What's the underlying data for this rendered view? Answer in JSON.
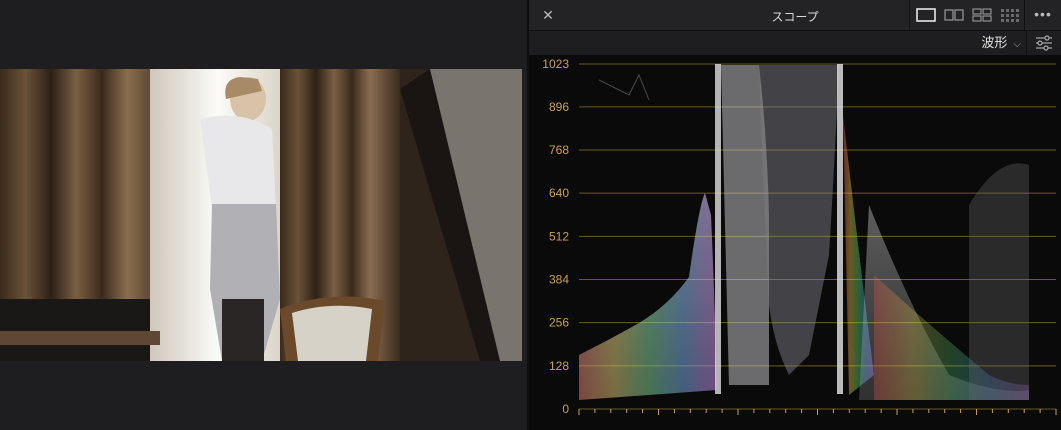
{
  "scope": {
    "title": "スコープ",
    "close_icon": "close-icon",
    "mode": "波形",
    "more_icon": "more-icon",
    "settings_icon": "sliders-icon",
    "layouts": [
      "single-view-icon",
      "dual-view-icon",
      "quad-view-icon",
      "multi-grid-icon"
    ]
  },
  "waveform": {
    "y_ticks": [
      "1023",
      "896",
      "768",
      "640",
      "512",
      "384",
      "256",
      "128",
      "0"
    ],
    "y_range": [
      0,
      1023
    ],
    "tick_color": "#c9a14a",
    "gridline_color": "#6b5a24"
  }
}
